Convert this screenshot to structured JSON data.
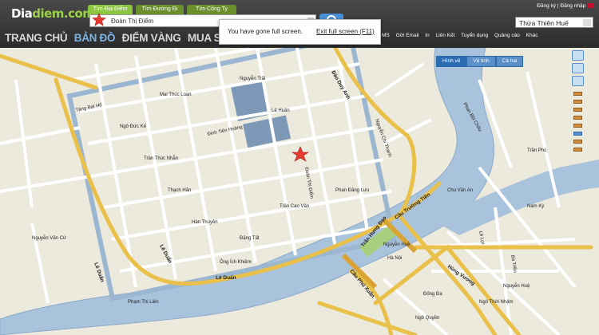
{
  "logo": {
    "part1": "Dia",
    "part2": "diem",
    "part3": ".com"
  },
  "tabs": [
    "Tìm Địa Điểm",
    "Tìm Đường Đi",
    "Tìm Công Ty"
  ],
  "search": {
    "value": "Đoàn Thị Điểm"
  },
  "province": {
    "selected": "Thừa Thiên Huế"
  },
  "toplinks": {
    "register": "Đăng ký",
    "login": "Đăng nhập"
  },
  "nav": [
    "TRANG CHỦ",
    "BẢN ĐỒ",
    "ĐIỂM VÀNG",
    "MUA SẮM"
  ],
  "subnav": [
    "MS",
    "Gửi Email",
    "In",
    "Liên Kết",
    "Tuyển dụng",
    "Quảng cáo",
    "Khác"
  ],
  "maptype": [
    "Hình vẽ",
    "Vệ tinh",
    "Cả hai"
  ],
  "toast": {
    "message": "You have gone full screen.",
    "exit": "Exit full screen (F11)"
  },
  "streets": {
    "le_duan_1": "Lê Duẩn",
    "le_duan_2": "Lê Duẩn",
    "le_duan_3": "Lê Duẩn",
    "dao_duy_anh": "Đào Duy Anh",
    "tran_hung_dao": "Trần Hưng Đạo",
    "cau_truong_tien": "Cầu Trường Tiền",
    "cau_phu_xuan": "Cầu Phú Xuân",
    "nguyen_hue": "Nguyễn Huệ",
    "hung_vuong": "Hùng Vương",
    "doan_thi_diem": "Đoàn Thị Điểm",
    "nguyen_chi_thanh": "Nguyễn Chí Thanh",
    "le_loi": "Lê Lợi",
    "ba_trieu": "Bà Triệu",
    "phan_boi_chau": "Phan Bội Châu",
    "nguyen_trai": "Nguyễn Trãi",
    "tang_bat_ho": "Tăng Bạt Hổ",
    "dinh_tien_hoang": "Đinh Tiên Hoàng",
    "ong_ich_khiem": "Ông Ích Khiêm",
    "thanh_gian": "Thạch Hãn",
    "tran_cao_van": "Trần Cao Vân",
    "ha_noi": "Hà Nội",
    "dong_da": "Đống Đa",
    "nguyen_hue_2": "Nguyễn Huệ",
    "pham_thi_lien": "Phạm Thị Liên",
    "nguyen_van_cu": "Nguyễn Văn Cừ",
    "a_ha": "Ngô Đức Kế",
    "lh": "Lê Huân",
    "ms": "Mai Thúc Loan",
    "ph": "Phan Đăng Lưu",
    "tt": "Trần Thúc Nhẫn",
    "nam_ky": "Nam Kỳ",
    "cd": "Chu Văn An",
    "nt": "Ngô Thời Nhậm",
    "hv": "Hàn Thuyên",
    "ngoc": "Ngô Quyền",
    "tp": "Trần Phú",
    "dq": "Đặng Tất"
  }
}
